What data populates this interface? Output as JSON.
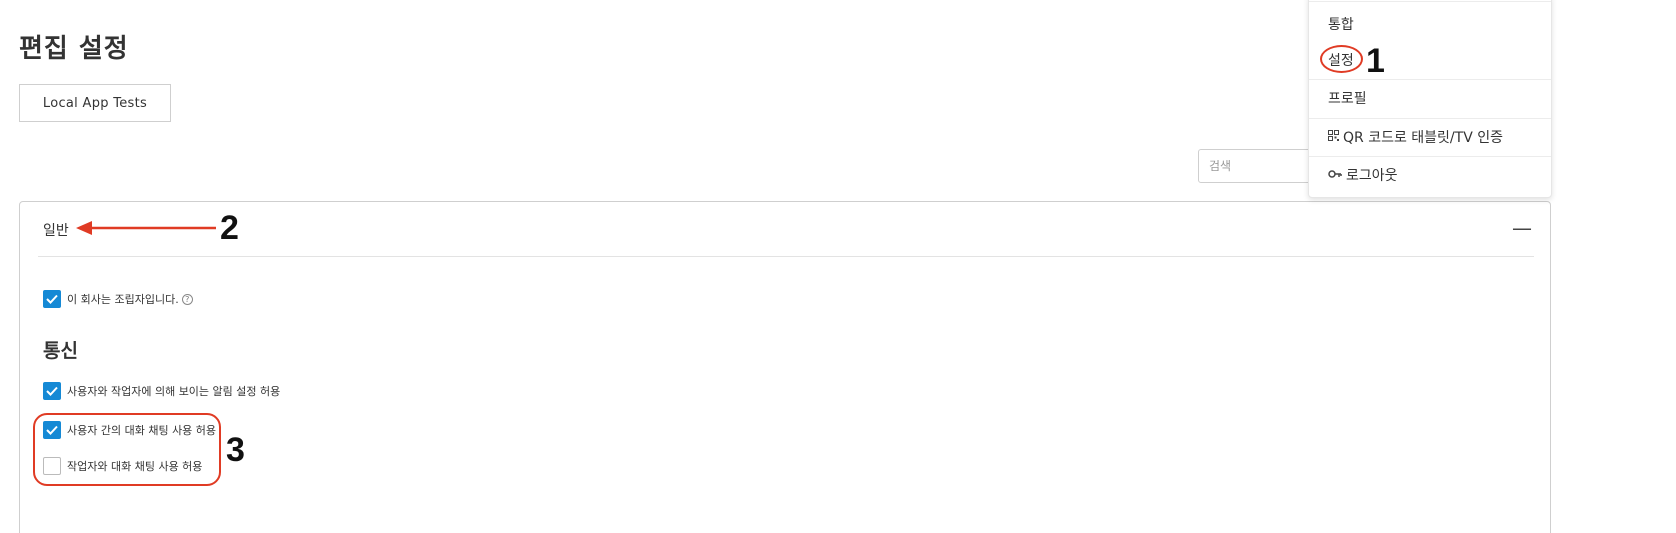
{
  "page": {
    "title": "편집 설정"
  },
  "app_button": {
    "label": "Local App Tests"
  },
  "search": {
    "placeholder": "검색"
  },
  "dropdown": {
    "items": [
      {
        "label": "통합"
      },
      {
        "label": "설정"
      },
      {
        "label": "프로필"
      },
      {
        "label": "QR 코드로 태블릿/TV 인증",
        "icon": "qr-code-icon"
      },
      {
        "label": "로그아웃",
        "icon": "key-icon"
      }
    ]
  },
  "general_panel": {
    "header": "일반",
    "collapse_symbol": "—",
    "assembler_checkbox": {
      "label": "이 회사는 조립자입니다.",
      "checked": true
    },
    "communication": {
      "title": "통신",
      "options": [
        {
          "label": "사용자와 작업자에 의해 보이는 알림 설정 허용",
          "checked": true
        },
        {
          "label": "사용자 간의 대화 채팅 사용 허용",
          "checked": true
        },
        {
          "label": "작업자와 대화 채팅 사용 허용",
          "checked": false
        }
      ]
    }
  },
  "annotations": {
    "one": "1",
    "two": "2",
    "three": "3",
    "color": "#e03b24"
  },
  "colors": {
    "checkbox_accent": "#1589d5"
  }
}
